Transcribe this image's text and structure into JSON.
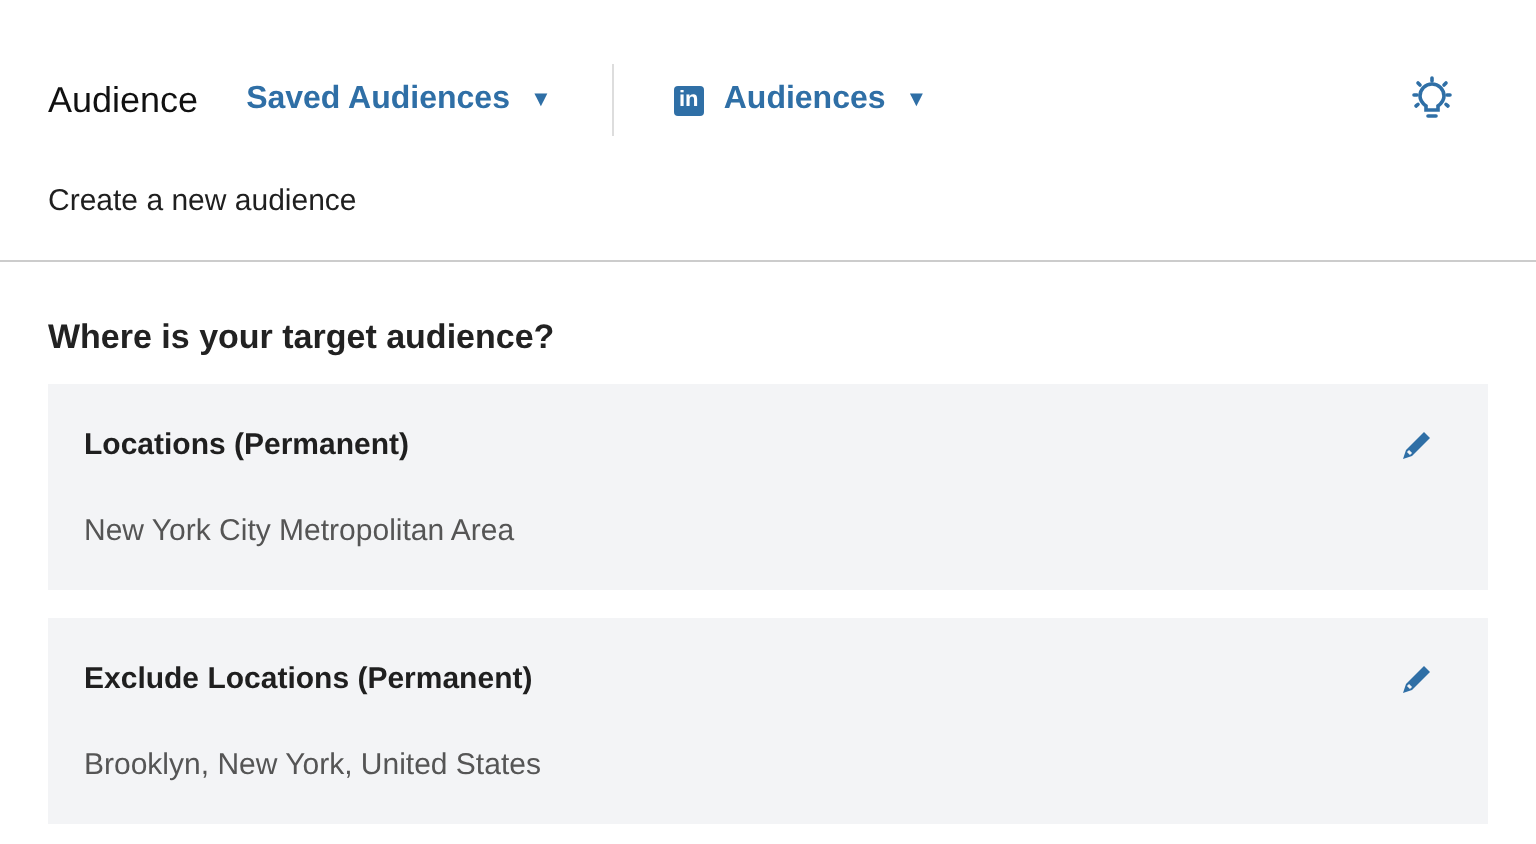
{
  "header": {
    "title": "Audience",
    "saved_menu": {
      "label": "Saved Audiences",
      "icon": "▼"
    },
    "network_menu": {
      "logo": "in",
      "label": "Audiences",
      "icon": "▼"
    }
  },
  "subtitle": "Create a new audience",
  "section": {
    "heading": "Where is your target audience?",
    "cards": [
      {
        "title": "Locations (Permanent)",
        "value": "New York City Metropolitan Area"
      },
      {
        "title": "Exclude Locations (Permanent)",
        "value": "Brooklyn, New York, United States"
      }
    ]
  }
}
